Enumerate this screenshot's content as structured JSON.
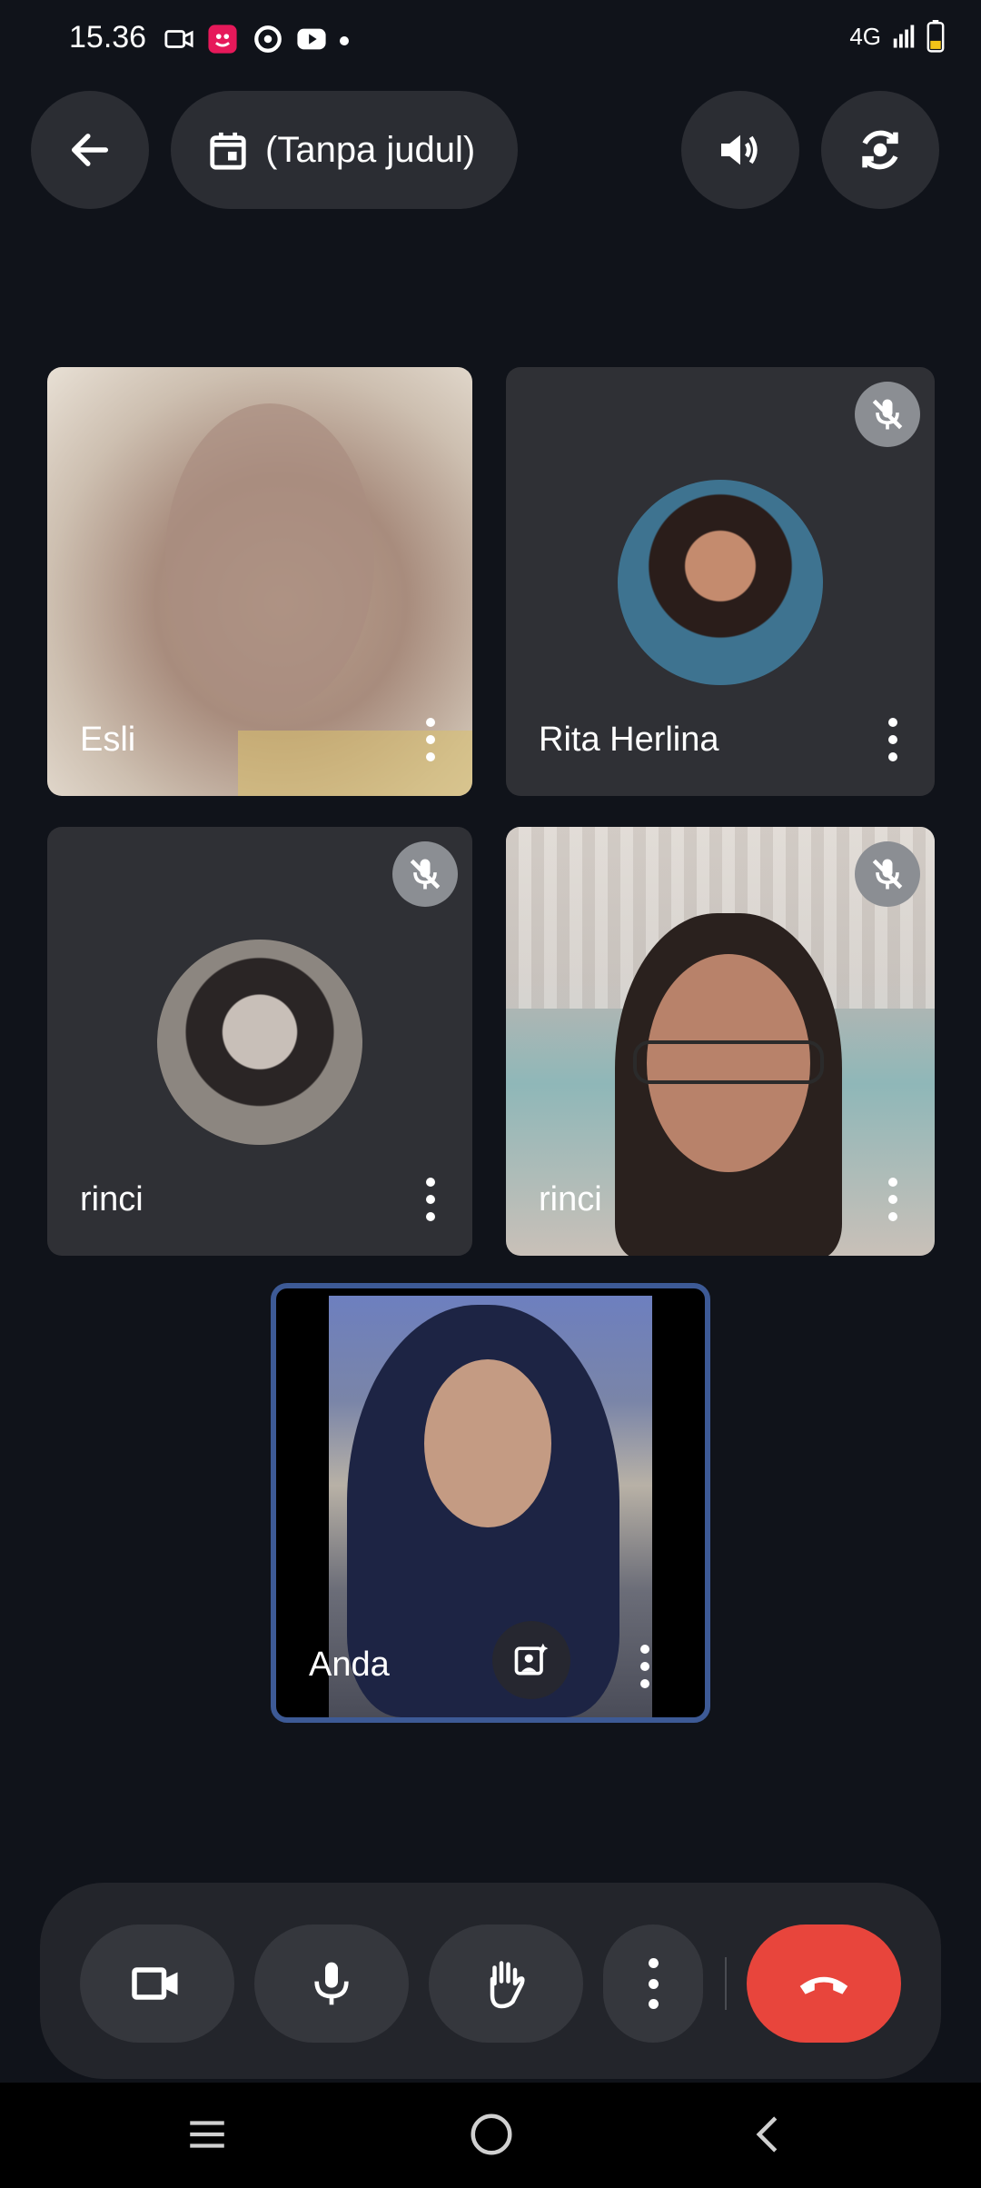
{
  "status_bar": {
    "time": "15.36",
    "network": "4G"
  },
  "header": {
    "meeting_title": "(Tanpa judul)"
  },
  "participants": [
    {
      "name": "Esli",
      "muted": false,
      "mode": "video"
    },
    {
      "name": "Rita Herlina",
      "muted": true,
      "mode": "avatar"
    },
    {
      "name": "rinci",
      "muted": true,
      "mode": "avatar"
    },
    {
      "name": "rinci",
      "muted": true,
      "mode": "video"
    },
    {
      "name": "Anda",
      "muted": false,
      "mode": "video",
      "self": true
    }
  ],
  "colors": {
    "end_call": "#e8453c",
    "self_border": "#3d5a96",
    "tile_bg": "#2f3035"
  },
  "icons": [
    "back-arrow-icon",
    "calendar-icon",
    "speaker-icon",
    "switch-camera-icon",
    "mic-off-icon",
    "more-vert-icon",
    "camera-icon",
    "mic-icon",
    "hand-icon",
    "end-call-icon",
    "menu-icon",
    "home-icon",
    "back-icon",
    "effects-icon"
  ]
}
